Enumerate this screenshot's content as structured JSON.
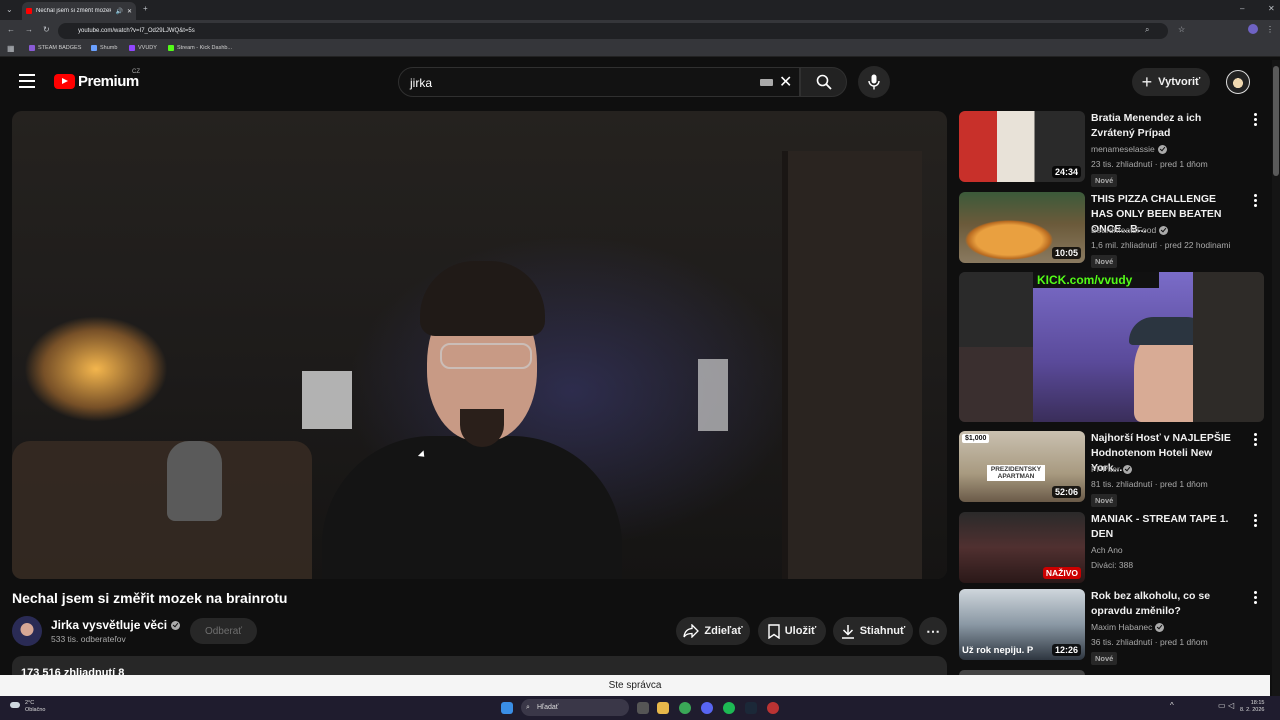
{
  "browser": {
    "tab_title": "Nechal jsem si změřit mozek",
    "url": "youtube.com/watch?v=I7_Od29LJWQ&t=5s",
    "bookmarks": [
      "STEAM BADGES",
      "Shumb",
      "VVUDY",
      "Stream - Kick Dashb..."
    ]
  },
  "header": {
    "logo_text": "Premium",
    "country": "CZ",
    "search_value": "jirka",
    "create_label": "Vytvoriť"
  },
  "video": {
    "title": "Nechal jsem si změřit mozek na brainrotu",
    "channel": "Jirka vysvětluje věci",
    "subscribers": "533 tis. odberateľov",
    "subscribe_label": "Odberať",
    "share_label": "Zdieľať",
    "save_label": "Uložiť",
    "download_label": "Stiahnuť",
    "views": "173 516 zhliadnutí  8"
  },
  "recommendations": [
    {
      "title": "Bratia Menendez a ich Zvrátený Prípad",
      "channel": "menameselassie",
      "verified": true,
      "meta": "23 tis. zhliadnutí · pred 1 dňom",
      "badge": "Nové",
      "duration": "24:34"
    },
    {
      "title": "THIS PIZZA CHALLENGE HAS ONLY BEEN BEATEN ONCE...B...",
      "channel": "BeardMeatsFood",
      "verified": true,
      "meta": "1,6 mil. zhliadnutí · pred 22 hodinami",
      "badge": "Nové",
      "duration": "10:05"
    },
    {
      "title": "Najhorší Hosť v NAJLEPŠIE Hodnotenom Hoteli New York...",
      "channel": "PPPlter",
      "verified": true,
      "meta": "81 tis. zhliadnutí · pred 1 dňom",
      "badge": "Nové",
      "duration": "52:06",
      "thumb_tag": "$1,000",
      "thumb_caption": "PREZIDENTSKY APARTMAN"
    },
    {
      "title": "MANIAK - STREAM TAPE 1. DEN",
      "channel": "Ach Ano",
      "verified": false,
      "meta": "Diváci: 388",
      "live": "NAŽIVO"
    },
    {
      "title": "Rok bez alkoholu, co se opravdu změnilo?",
      "channel": "Maxim Habanec",
      "verified": true,
      "meta": "36 tis. zhliadnutí · pred 1 dňom",
      "badge": "Nové",
      "duration": "12:26",
      "thumb_caption": "Už rok nepiju. P"
    }
  ],
  "kick_banner": "KICK.com/vvudy",
  "admin_bar": "Ste správca",
  "taskbar": {
    "weather_temp": "2°C",
    "weather_desc": "Oblačno",
    "search_placeholder": "Hľadať",
    "time": "18:15",
    "date": "8. 2. 2026"
  },
  "colors": {
    "brand_red": "#ff0000",
    "background": "#0f0f0f",
    "kick_green": "#53fc18",
    "live_red": "#cc0000"
  }
}
